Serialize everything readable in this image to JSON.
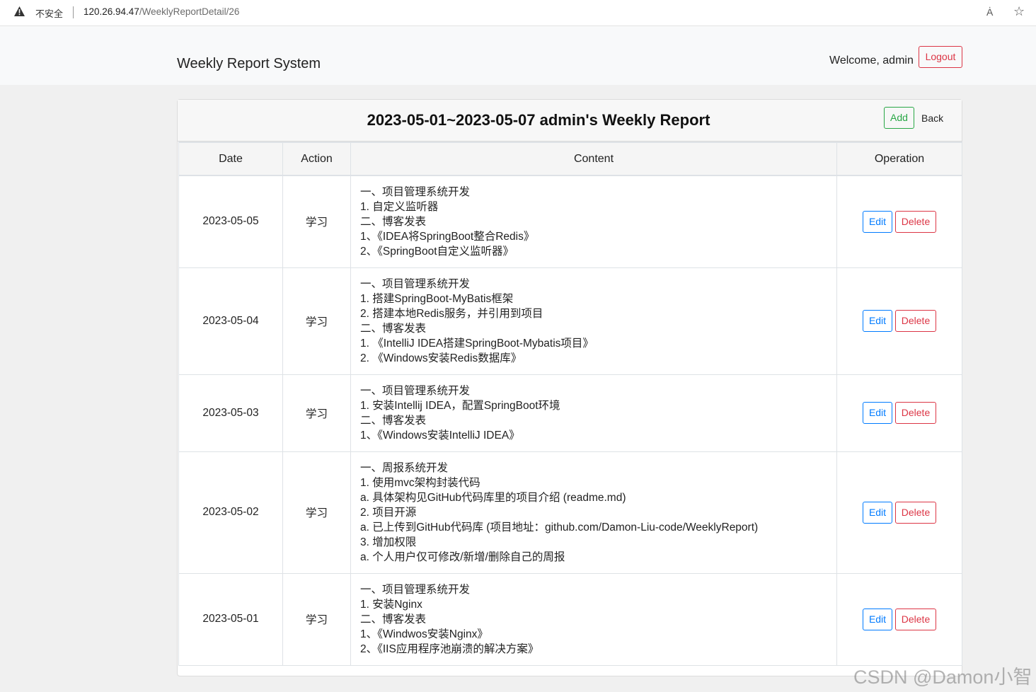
{
  "browser": {
    "security_label": "不安全",
    "url_host": "120.26.94.47",
    "url_path": "/WeeklyReportDetail/26",
    "read_aloud_glyph": "Ȧ",
    "favorite_glyph": "☆"
  },
  "header": {
    "brand": "Weekly Report System",
    "welcome": "Welcome, admin",
    "logout_label": "Logout"
  },
  "card": {
    "title": "2023-05-01~2023-05-07 admin's Weekly Report",
    "add_label": "Add",
    "back_label": "Back"
  },
  "table": {
    "columns": [
      "Date",
      "Action",
      "Content",
      "Operation"
    ],
    "edit_label": "Edit",
    "delete_label": "Delete",
    "rows": [
      {
        "date": "2023-05-05",
        "action": "学习",
        "content": [
          "一、项目管理系统开发",
          "1. 自定义监听器",
          "二、博客发表",
          "1、《IDEA将SpringBoot整合Redis》",
          "2、《SpringBoot自定义监听器》"
        ]
      },
      {
        "date": "2023-05-04",
        "action": "学习",
        "content": [
          "一、项目管理系统开发",
          "1. 搭建SpringBoot-MyBatis框架",
          "2. 搭建本地Redis服务，并引用到项目",
          "二、博客发表",
          "1. 《IntelliJ IDEA搭建SpringBoot-Mybatis项目》",
          "2. 《Windows安装Redis数据库》"
        ]
      },
      {
        "date": "2023-05-03",
        "action": "学习",
        "content": [
          "一、项目管理系统开发",
          "1. 安装Intellij IDEA，配置SpringBoot环境",
          "二、博客发表",
          "1、《Windows安装IntelliJ IDEA》"
        ]
      },
      {
        "date": "2023-05-02",
        "action": "学习",
        "content": [
          "一、周报系统开发",
          "1. 使用mvc架构封装代码",
          "a. 具体架构见GitHub代码库里的项目介绍 (readme.md)",
          "2. 项目开源",
          "a. 已上传到GitHub代码库 (项目地址：github.com/Damon-Liu-code/WeeklyReport)",
          "3. 增加权限",
          "a. 个人用户仅可修改/新增/删除自己的周报"
        ]
      },
      {
        "date": "2023-05-01",
        "action": "学习",
        "content": [
          "一、项目管理系统开发",
          "1. 安装Nginx",
          "二、博客发表",
          "1、《Windwos安装Nginx》",
          "2、《IIS应用程序池崩溃的解决方案》"
        ]
      }
    ]
  },
  "watermark": "CSDN @Damon小智",
  "colors": {
    "danger": "#dc3545",
    "success": "#28a745",
    "primary": "#007bff"
  }
}
